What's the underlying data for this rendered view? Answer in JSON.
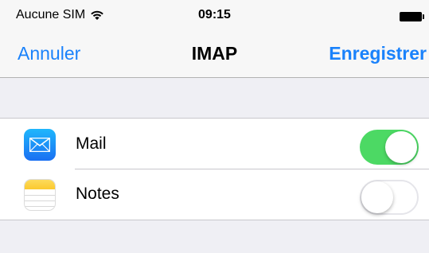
{
  "status_bar": {
    "carrier": "Aucune SIM",
    "time": "09:15",
    "wifi_icon": "wifi-icon",
    "battery_icon": "battery-icon"
  },
  "nav": {
    "left_label": "Annuler",
    "title": "IMAP",
    "right_label": "Enregistrer"
  },
  "rows": [
    {
      "label": "Mail",
      "icon": "mail-icon",
      "enabled": true
    },
    {
      "label": "Notes",
      "icon": "notes-icon",
      "enabled": false
    }
  ],
  "colors": {
    "accent": "#1a82fb",
    "toggle_on": "#4cd964",
    "background": "#efeff4"
  }
}
